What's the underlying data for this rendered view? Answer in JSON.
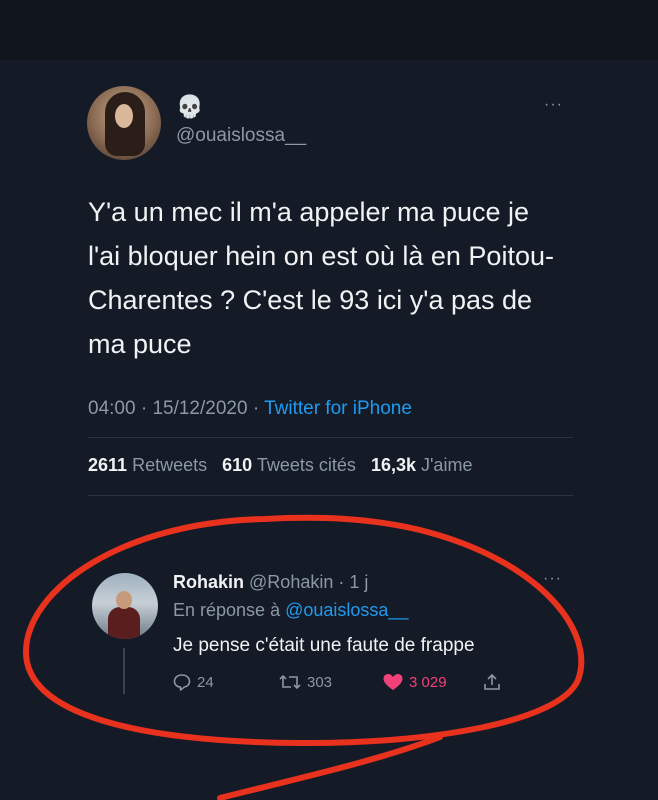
{
  "main_tweet": {
    "emoji": "💀",
    "handle": "@ouaislossa__",
    "more": "···",
    "text": "Y'a un mec il m'a appeler ma puce je l'ai bloquer hein on est où là en Poitou-Charentes ? C'est le 93 ici y'a pas de ma puce",
    "time": "04:00",
    "date": "15/12/2020",
    "source": "Twitter for iPhone",
    "stats": {
      "retweets_count": "2611",
      "retweets_label": "Retweets",
      "quotes_count": "610",
      "quotes_label": "Tweets cités",
      "likes_count": "16,3k",
      "likes_label": "J'aime"
    }
  },
  "reply": {
    "name": "Rohakin",
    "handle": "@Rohakin",
    "age": "1 j",
    "more": "···",
    "reply_to_prefix": "En réponse à",
    "reply_to_handle": "@ouaislossa__",
    "text": "Je pense c'était une faute de frappe",
    "actions": {
      "replies": "24",
      "retweets": "303",
      "likes": "3 029"
    }
  },
  "colors": {
    "background": "#141a26",
    "link": "#1d9bf0",
    "like": "#f0417a",
    "annotation": "#e8321e"
  },
  "icons": [
    "skull-emoji",
    "more-icon",
    "reply-icon",
    "retweet-icon",
    "heart-icon",
    "share-icon"
  ]
}
